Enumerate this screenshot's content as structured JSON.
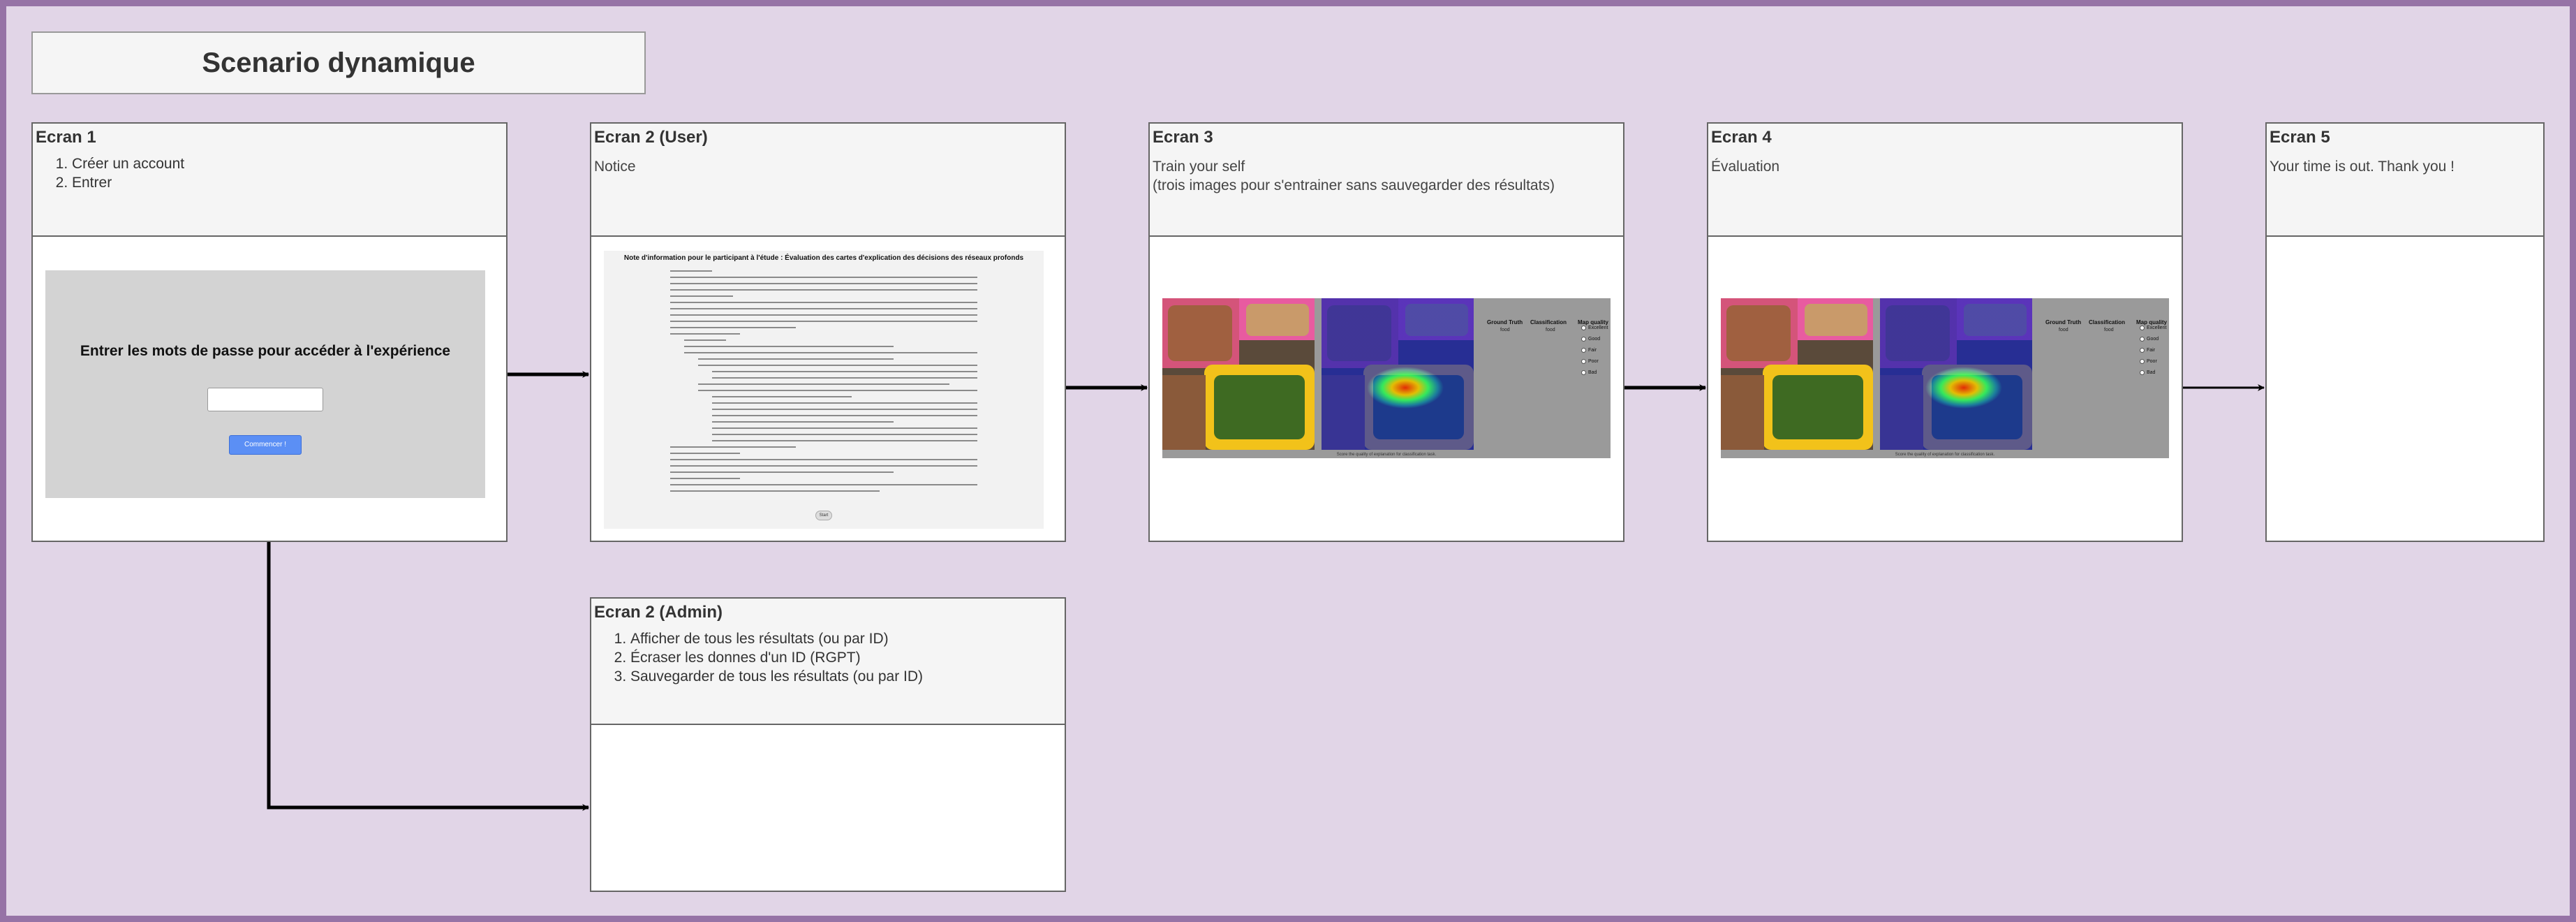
{
  "diagram": {
    "title": "Scenario dynamique",
    "colors": {
      "background": "#e1d5e7",
      "frame": "#9673a6",
      "card_head": "#f5f5f5",
      "button": "#5b8ff5"
    }
  },
  "ecran1": {
    "title": "Ecran 1",
    "steps": [
      "Créer un account",
      "Entrer"
    ],
    "prompt": "Entrer les mots de passe pour accéder à l'expérience",
    "button": "Commencer !"
  },
  "ecran2_user": {
    "title": "Ecran 2 (User)",
    "text": "Notice",
    "doc_title": "Note d'information pour le participant à l'étude : Évaluation des cartes d'explication des décisions des réseaux profonds",
    "doc_button": "Start"
  },
  "ecran3": {
    "title": "Ecran 3",
    "text_line1": "Train your self",
    "text_line2": "(trois images pour s'entrainer sans sauvegarder des résultats)"
  },
  "ecran4": {
    "title": "Ecran 4",
    "text": "Évaluation"
  },
  "ecran5": {
    "title": "Ecran 5",
    "text": "Your time is out. Thank you !"
  },
  "ecran2_admin": {
    "title": "Ecran 2 (Admin)",
    "items": [
      "Afficher de tous les résultats (ou par ID)",
      "Écraser les donnes d'un ID (RGPT)",
      "Sauvegarder de tous les résultats (ou par ID)"
    ]
  },
  "eval_panel": {
    "col_ground_truth": "Ground Truth",
    "col_classification": "Classification",
    "col_map_quality": "Map quality",
    "ground_truth_value": "food",
    "classification_value": "food",
    "quality_options": [
      "Excellent",
      "Good",
      "Fair",
      "Poor",
      "Bad"
    ],
    "caption": "Score the quality of explanation for classification task. "
  }
}
